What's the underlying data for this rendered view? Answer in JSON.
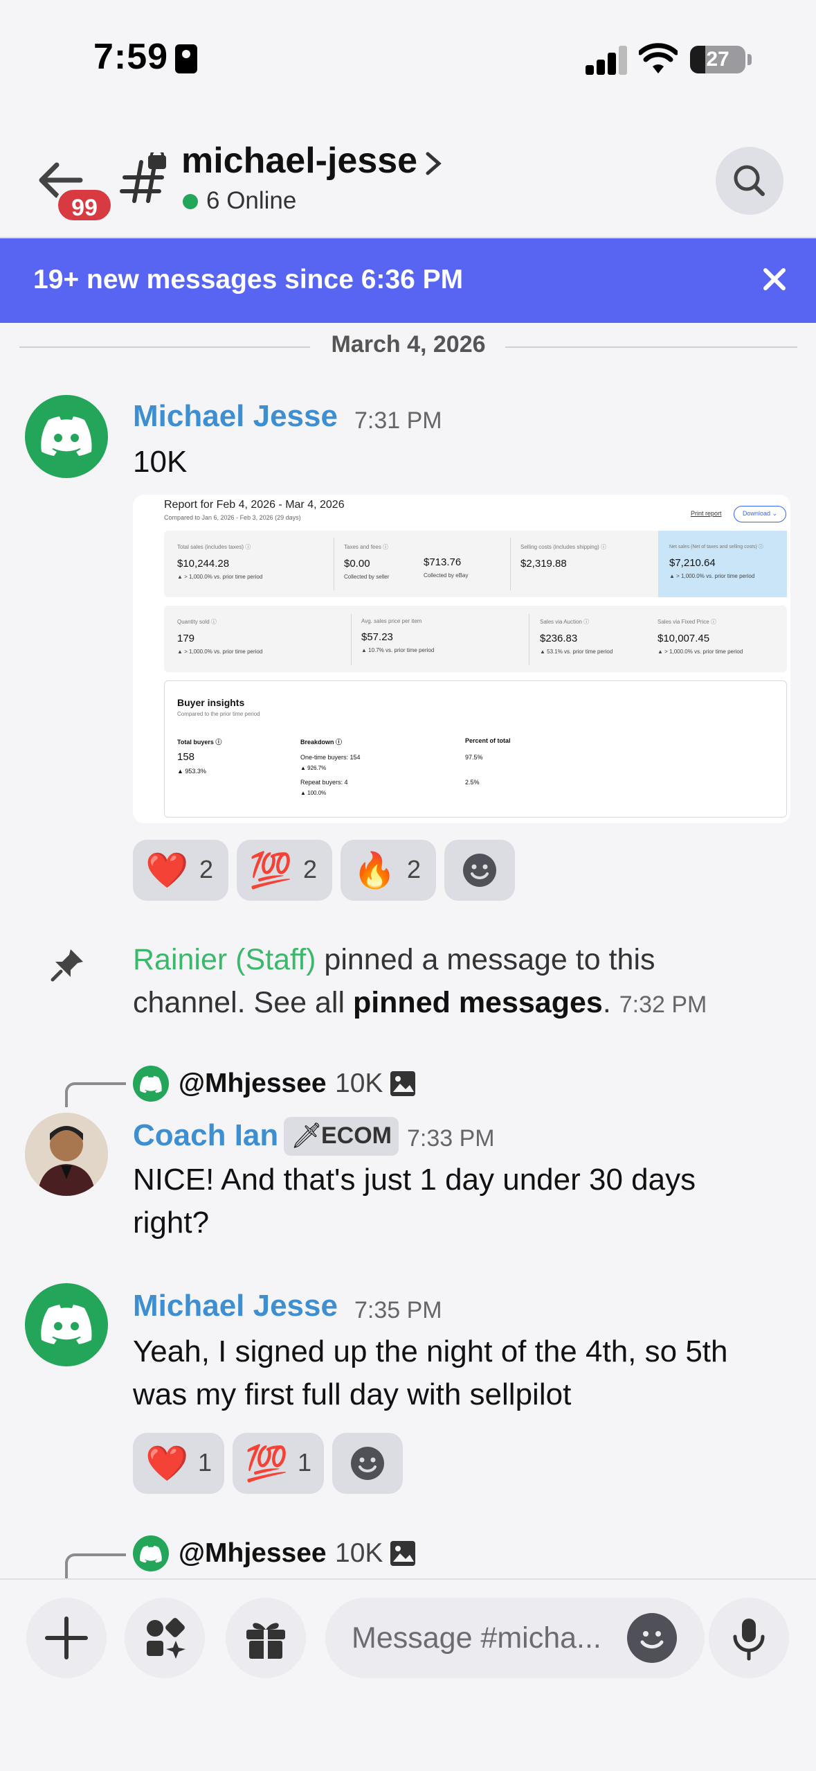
{
  "status_bar": {
    "time": "7:59",
    "battery": "27",
    "battery_level": 0.27
  },
  "header": {
    "unread_badge": "99",
    "channel_name": "michael-jesse",
    "online": "6 Online"
  },
  "banner": {
    "text": "19+ new messages since 6:36 PM"
  },
  "date_divider": "March 4, 2026",
  "messages": [
    {
      "author": "Michael Jesse",
      "time": "7:31 PM",
      "text": "10K",
      "report": {
        "title": "Report for Feb 4, 2026 - Mar 4, 2026",
        "subtitle": "Compared to Jan 6, 2026 - Feb 3, 2026 (29 days)",
        "print": "Print report",
        "download": "Download ⌄",
        "row1": [
          {
            "label": "Total sales (includes taxes) ⓘ",
            "value": "$10,244.28",
            "note": "▲ > 1,000.0% vs. prior time period"
          },
          {
            "label": "Taxes and fees ⓘ",
            "value": "$0.00",
            "note": "Collected by seller"
          },
          {
            "label": "",
            "value": "$713.76",
            "note": "Collected by eBay"
          },
          {
            "label": "Selling costs (includes shipping) ⓘ",
            "value": "$2,319.88",
            "note": ""
          },
          {
            "label": "Net sales (Net of taxes and selling costs) ⓘ",
            "value": "$7,210.64",
            "note": "▲ > 1,000.0% vs. prior time period"
          }
        ],
        "row2": [
          {
            "label": "Quantity sold ⓘ",
            "value": "179",
            "note": "▲ > 1,000.0% vs. prior time period"
          },
          {
            "label": "Avg. sales price per item",
            "value": "$57.23",
            "note": "▲ 10.7% vs. prior time period"
          },
          {
            "label": "Sales via Auction ⓘ",
            "value": "$236.83",
            "note": "▲ 53.1% vs. prior time period"
          },
          {
            "label": "Sales via Fixed Price ⓘ",
            "value": "$10,007.45",
            "note": "▲ > 1,000.0% vs. prior time period"
          }
        ],
        "buyer": {
          "title": "Buyer insights",
          "subtitle": "Compared to the prior time period",
          "total_label": "Total buyers ⓘ",
          "total_value": "158",
          "total_note": "▲ 953.3%",
          "breakdown_label": "Breakdown ⓘ",
          "percent_label": "Percent of total",
          "one_time": "One-time buyers: 154",
          "one_time_note": "▲ 926.7%",
          "one_time_pct": "97.5%",
          "repeat": "Repeat buyers: 4",
          "repeat_note": "▲ 100.0%",
          "repeat_pct": "2.5%"
        }
      },
      "reactions": [
        {
          "emoji": "❤️",
          "count": "2"
        },
        {
          "emoji": "💯",
          "count": "2"
        },
        {
          "emoji": "🔥",
          "count": "2"
        }
      ]
    },
    {
      "system": true,
      "actor": "Rainier (Staff)",
      "text_a": " pinned a message to this channel. See all ",
      "link": "pinned messages",
      "text_b": ". ",
      "time": "7:32 PM"
    },
    {
      "reply_to": {
        "name": "@Mhjessee",
        "text": "10K"
      },
      "author": "Coach Ian",
      "tag": "ECOM",
      "tag_emoji": "🗡",
      "time": "7:33 PM",
      "text": "NICE! And that's just 1 day under 30 days right?"
    },
    {
      "author": "Michael Jesse",
      "time": "7:35 PM",
      "text": "Yeah, I signed up the night of the 4th, so 5th was my first full day with sellpilot",
      "reactions": [
        {
          "emoji": "❤️",
          "count": "1"
        },
        {
          "emoji": "💯",
          "count": "1"
        }
      ]
    },
    {
      "reply_to": {
        "name": "@Mhjessee",
        "text": "10K"
      }
    }
  ],
  "composer": {
    "placeholder": "Message #micha..."
  },
  "colors": {
    "accent": "#5865f2",
    "online": "#23a55a",
    "author": "#3d8fd1",
    "staff": "#3cb86c",
    "badge": "#d83a42"
  }
}
